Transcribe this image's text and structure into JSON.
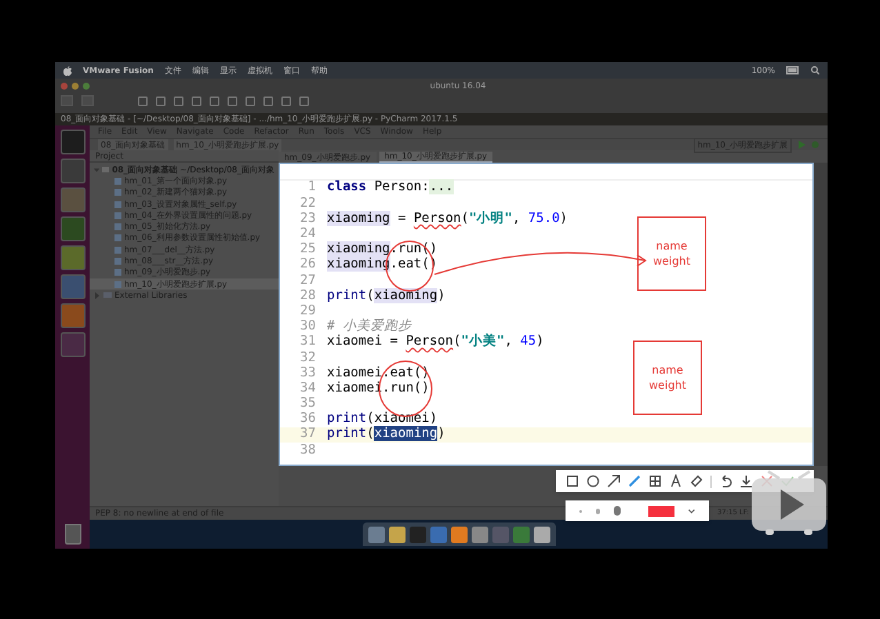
{
  "mac_menu": [
    "VMware Fusion",
    "文件",
    "编辑",
    "显示",
    "虚拟机",
    "窗口",
    "帮助"
  ],
  "mac_status": "100%",
  "vm_window": {
    "title": "ubuntu 16.04"
  },
  "ubuntu_title": "08_面向对象基础 - [~/Desktop/08_面向对象基础] - .../hm_10_小明爱跑步扩展.py - PyCharm 2017.1.5",
  "ide": {
    "menu": [
      "File",
      "Edit",
      "View",
      "Navigate",
      "Code",
      "Refactor",
      "Run",
      "Tools",
      "VCS",
      "Window",
      "Help"
    ],
    "breadcrumb": [
      "08_面向对象基础",
      "hm_10_小明爱跑步扩展.py"
    ],
    "run_config": "hm_10_小明爱跑步扩展",
    "project_label": "Project",
    "tree": {
      "label": "08_面向对象基础",
      "path": "~/Desktop/08_面向对象",
      "expanded": true,
      "children": [
        {
          "label": "hm_01_第一个面向对象.py",
          "selected": false
        },
        {
          "label": "hm_02_新建两个猫对象.py",
          "selected": false
        },
        {
          "label": "hm_03_设置对象属性_self.py",
          "selected": false
        },
        {
          "label": "hm_04_在外界设置属性的问题.py",
          "selected": false
        },
        {
          "label": "hm_05_初始化方法.py",
          "selected": false
        },
        {
          "label": "hm_06_利用参数设置属性初始值.py",
          "selected": false
        },
        {
          "label": "hm_07___del__方法.py",
          "selected": false
        },
        {
          "label": "hm_08___str__方法.py",
          "selected": false
        },
        {
          "label": "hm_09_小明爱跑步.py",
          "selected": false
        },
        {
          "label": "hm_10_小明爱跑步扩展.py",
          "selected": true
        }
      ]
    },
    "external": "External Libraries",
    "tabs": [
      {
        "label": "hm_09_小明爱跑步.py",
        "selected": false
      },
      {
        "label": "hm_10_小明爱跑步扩展.py",
        "selected": true
      }
    ],
    "code": [
      {
        "number": "1",
        "current": false,
        "tokens": [
          {
            "text": "class",
            "kind": "keyword"
          },
          {
            "text": " Person:",
            "kind": "plain"
          },
          {
            "text": "...",
            "kind": "folded"
          }
        ]
      },
      {
        "number": "22",
        "current": false
      },
      {
        "number": "23",
        "current": false,
        "tokens": [
          {
            "text": "xiaoming",
            "kind": "usage"
          },
          {
            "text": " = ",
            "kind": "plain"
          },
          {
            "text": "Person",
            "kind": "warning"
          },
          {
            "text": "(",
            "kind": "plain"
          },
          {
            "text": "\"小明\"",
            "kind": "string"
          },
          {
            "text": ", ",
            "kind": "plain"
          },
          {
            "text": "75.0",
            "kind": "number"
          },
          {
            "text": ")",
            "kind": "plain"
          }
        ]
      },
      {
        "number": "24",
        "current": false
      },
      {
        "number": "25",
        "current": false,
        "tokens": [
          {
            "text": "xiaoming",
            "kind": "usage"
          },
          {
            "text": ".run()",
            "kind": "plain"
          }
        ]
      },
      {
        "number": "26",
        "current": false,
        "tokens": [
          {
            "text": "xiaoming",
            "kind": "usage"
          },
          {
            "text": ".eat()",
            "kind": "plain"
          }
        ]
      },
      {
        "number": "27",
        "current": false
      },
      {
        "number": "28",
        "current": false,
        "tokens": [
          {
            "text": "print",
            "kind": "builtin"
          },
          {
            "text": "(",
            "kind": "plain"
          },
          {
            "text": "xiaoming",
            "kind": "usage"
          },
          {
            "text": ")",
            "kind": "plain"
          }
        ]
      },
      {
        "number": "29",
        "current": false
      },
      {
        "number": "30",
        "current": false,
        "tokens": [
          {
            "text": "# 小美爱跑步",
            "kind": "comment"
          }
        ]
      },
      {
        "number": "31",
        "current": false,
        "tokens": [
          {
            "text": "xiaomei = ",
            "kind": "plain"
          },
          {
            "text": "Person",
            "kind": "warning"
          },
          {
            "text": "(",
            "kind": "plain"
          },
          {
            "text": "\"小美\"",
            "kind": "string"
          },
          {
            "text": ", ",
            "kind": "plain"
          },
          {
            "text": "45",
            "kind": "number"
          },
          {
            "text": ")",
            "kind": "plain"
          }
        ]
      },
      {
        "number": "32",
        "current": false
      },
      {
        "number": "33",
        "current": false,
        "tokens": [
          {
            "text": "xiaomei.eat()",
            "kind": "plain"
          }
        ]
      },
      {
        "number": "34",
        "current": false,
        "tokens": [
          {
            "text": "xiaomei.run()",
            "kind": "plain"
          }
        ]
      },
      {
        "number": "35",
        "current": false
      },
      {
        "number": "36",
        "current": false,
        "tokens": [
          {
            "text": "print",
            "kind": "builtin"
          },
          {
            "text": "(xiaomei)",
            "kind": "plain"
          }
        ]
      },
      {
        "number": "37",
        "current": true,
        "tokens": [
          {
            "text": "print",
            "kind": "builtin"
          },
          {
            "text": "(",
            "kind": "plain"
          },
          {
            "text": "xiaoming",
            "kind": "selection"
          },
          {
            "text": ")",
            "kind": "plain"
          }
        ]
      },
      {
        "number": "38",
        "current": false
      }
    ],
    "notes": [
      {
        "lines": [
          "name",
          "weight"
        ]
      },
      {
        "lines": [
          "name",
          "weight"
        ]
      }
    ],
    "status": "PEP 8: no newline at end of file",
    "position": "37:15 LF:"
  },
  "markup_toolbar": {
    "tools": [
      {
        "kind": "rectangle",
        "selected": false
      },
      {
        "kind": "ellipse",
        "selected": false
      },
      {
        "kind": "arrow",
        "selected": false
      },
      {
        "kind": "pen",
        "selected": true
      },
      {
        "kind": "mosaic",
        "selected": false
      },
      {
        "kind": "text",
        "selected": false
      },
      {
        "kind": "eraser",
        "selected": false
      },
      {
        "kind": "undo",
        "selected": false
      },
      {
        "kind": "save",
        "selected": false
      },
      {
        "kind": "cancel"
      },
      {
        "kind": "confirm"
      }
    ],
    "sizes": [
      {
        "selected": false
      },
      {
        "selected": false
      },
      {
        "selected": true
      }
    ],
    "color": "#f5303e"
  }
}
